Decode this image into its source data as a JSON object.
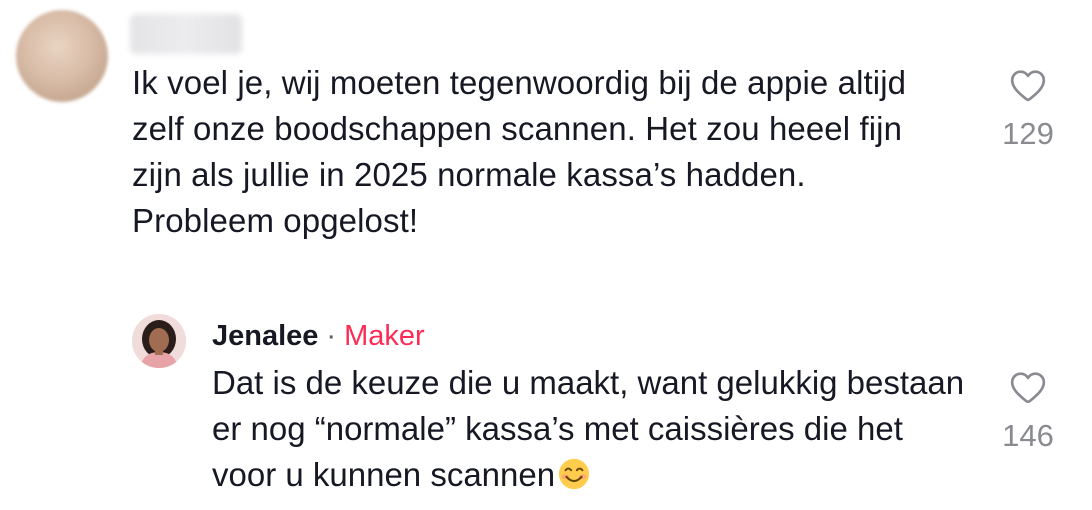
{
  "comments": [
    {
      "text": "Ik voel je, wij moeten tegenwoordig bij de appie altijd zelf onze boodschappen scannen. Het zou heeel fijn zijn als jullie in 2025 normale kassa’s hadden. Probleem opgelost!",
      "likes": "129",
      "like_icon": "heart-outline-icon"
    }
  ],
  "reply": {
    "author": "Jenalee",
    "separator": "·",
    "badge": "Maker",
    "text": "Dat is de keuze die u maakt, want gelukkig bestaan er nog “normale” kassa’s met caissières die het voor u kunnen scannen",
    "emoji": "smiling-face-emoji",
    "likes": "146",
    "like_icon": "heart-outline-icon"
  },
  "colors": {
    "text": "#161823",
    "muted": "#8a8b91",
    "badge": "#fe2c55"
  }
}
